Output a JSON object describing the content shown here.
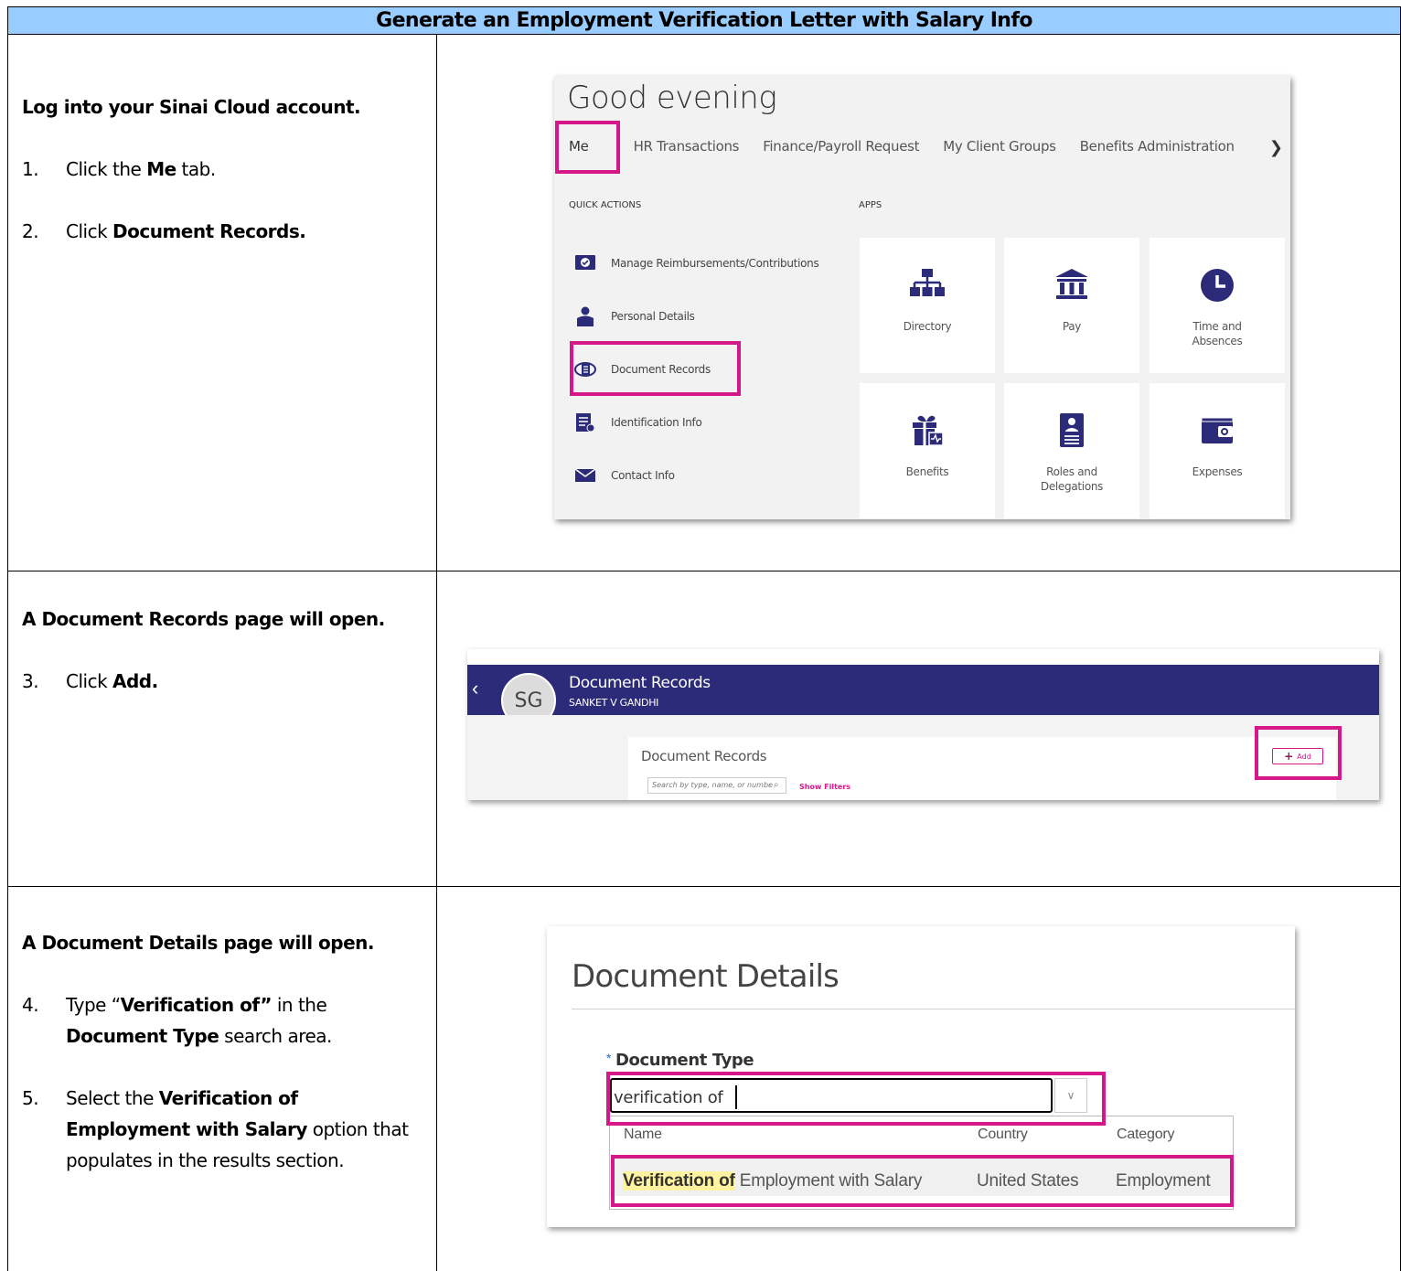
{
  "title": "Generate an Employment Verification Letter with Salary Info",
  "section1": {
    "lead": "Log into your Sinai Cloud account.",
    "steps": [
      {
        "num": "1.",
        "pre": "Click the ",
        "bold": "Me",
        "post": " tab."
      },
      {
        "num": "2.",
        "pre": "Click ",
        "bold": "Document Records.",
        "post": ""
      }
    ],
    "shot": {
      "greeting": "Good evening",
      "tabs": [
        "Me",
        "HR Transactions",
        "Finance/Payroll Request",
        "My Client Groups",
        "Benefits Administration"
      ],
      "tabs_more_icon": "chevron-right-icon",
      "quick_actions_heading": "QUICK ACTIONS",
      "apps_heading": "APPS",
      "quick_actions": [
        {
          "label": "Manage Reimbursements/Contributions",
          "icon": "reimbursement-icon"
        },
        {
          "label": "Personal Details",
          "icon": "person-icon"
        },
        {
          "label": "Document Records",
          "icon": "document-records-icon"
        },
        {
          "label": "Identification Info",
          "icon": "identification-icon"
        },
        {
          "label": "Contact Info",
          "icon": "envelope-icon"
        }
      ],
      "apps": [
        {
          "label": "Directory",
          "icon": "org-chart-icon"
        },
        {
          "label": "Pay",
          "icon": "bank-icon"
        },
        {
          "label": "Time and Absences",
          "icon": "clock-icon"
        },
        {
          "label": "Benefits",
          "icon": "gift-icon"
        },
        {
          "label": "Roles and Delegations",
          "icon": "id-badge-icon"
        },
        {
          "label": "Expenses",
          "icon": "wallet-icon"
        }
      ],
      "highlight_color": "#d6178a"
    }
  },
  "section2": {
    "lead": "A Document Records page will open.",
    "steps": [
      {
        "num": "3.",
        "pre": "Click ",
        "bold": "Add.",
        "post": ""
      }
    ],
    "shot": {
      "avatar_initials": "SG",
      "header_title": "Document Records",
      "person_name": "SANKET V GANDHI",
      "card_title": "Document Records",
      "search_placeholder": "Search by type, name, or numbe",
      "show_filters": "Show Filters",
      "add_label": "Add",
      "header_color": "#2b2b7a"
    }
  },
  "section3": {
    "lead": "A Document Details page will open.",
    "step4": {
      "num": "4.",
      "t1": "Type “",
      "b1": "Verification of”",
      "t2": " in the ",
      "b2": "Document Type",
      "t3": " search area."
    },
    "step5": {
      "num": "5.",
      "t1": "Select the ",
      "b1": "Verification of Employment with Salary",
      "t2": " option that populates in the results section."
    },
    "shot": {
      "page_title": "Document Details",
      "required_mark": "*",
      "field_label": "Document Type",
      "input_value": "verification of",
      "columns": [
        "Name",
        "Country",
        "Category"
      ],
      "result": {
        "name_match": "Verification of",
        "name_rest": " Employment with Salary",
        "country": "United States",
        "category": "Employment"
      }
    }
  }
}
